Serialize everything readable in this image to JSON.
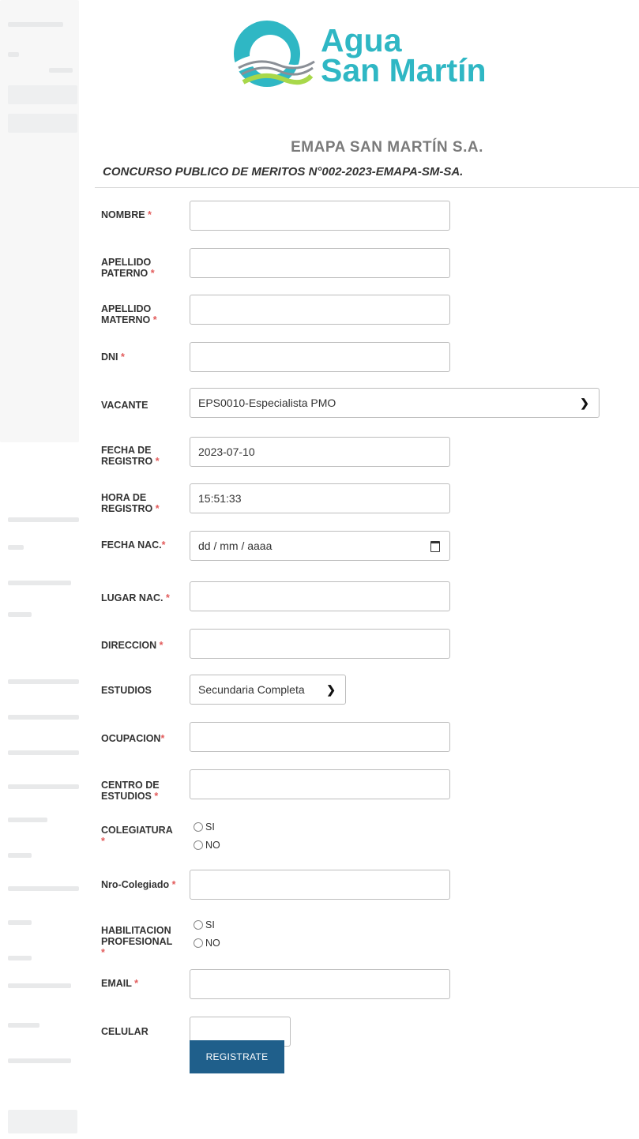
{
  "header": {
    "logo_line1": "Agua",
    "logo_line2": "San Martín",
    "company": "EMAPA SAN MARTÍN S.A.",
    "subtitle": "CONCURSO PUBLICO DE MERITOS N°002-2023-EMAPA-SM-SA."
  },
  "colors": {
    "brand": "#2fb7c4",
    "required": "#e25b5b",
    "button": "#1f5f8b"
  },
  "form": {
    "nombre_label": "NOMBRE",
    "apellido_paterno_label1": "APELLIDO",
    "apellido_paterno_label2": "PATERNO",
    "apellido_materno_label1": "APELLIDO",
    "apellido_materno_label2": "MATERNO",
    "dni_label": "DNI",
    "vacante_label": "VACANTE",
    "vacante_value": "EPS0010-Especialista PMO",
    "fecha_registro_label1": "FECHA DE",
    "fecha_registro_label2": "REGISTRO",
    "fecha_registro_value": "2023-07-10",
    "hora_registro_label1": "HORA DE",
    "hora_registro_label2": "REGISTRO",
    "hora_registro_value": "15:51:33",
    "fecha_nac_label": "FECHA NAC.",
    "fecha_nac_placeholder": "dd / mm / aaaa",
    "lugar_nac_label": "LUGAR NAC.",
    "direccion_label": "DIRECCION",
    "estudios_label": "ESTUDIOS",
    "estudios_value": "Secundaria Completa",
    "ocupacion_label": "OCUPACION",
    "centro_estudios_label1": "CENTRO DE",
    "centro_estudios_label2": "ESTUDIOS",
    "colegiatura_label": "COLEGIATURA",
    "nro_colegiado_label": "Nro-Colegiado",
    "habilitacion_label1": "HABILITACION",
    "habilitacion_label2": "PROFESIONAL",
    "email_label": "EMAIL",
    "celular_label": "CELULAR",
    "option_si": "SI",
    "option_no": "NO",
    "required_mark": "*",
    "submit_label": "REGISTRATE"
  }
}
